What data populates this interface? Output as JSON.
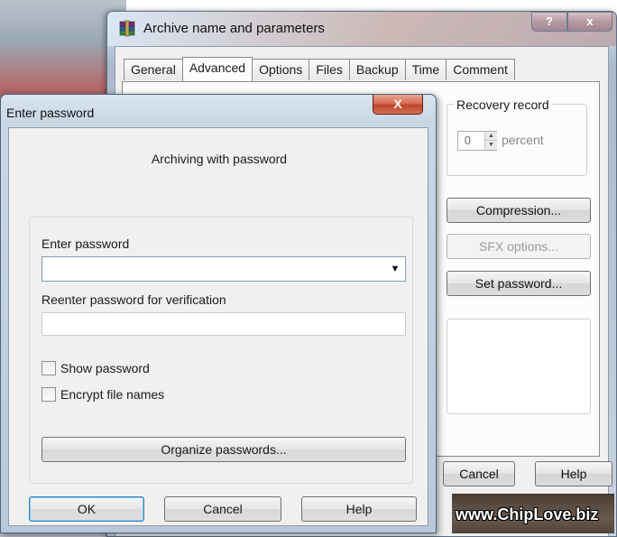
{
  "back_window": {
    "title": "Archive name and parameters",
    "caption_help": "?",
    "caption_close": "x",
    "tabs": [
      "General",
      "Advanced",
      "Options",
      "Files",
      "Backup",
      "Time",
      "Comment"
    ],
    "active_tab": "Advanced",
    "recovery": {
      "label": "Recovery record",
      "value": "0",
      "unit": "percent"
    },
    "buttons": {
      "compression": "Compression...",
      "sfx_options": "SFX options...",
      "set_password": "Set password...",
      "cancel": "Cancel",
      "help": "Help"
    }
  },
  "password_dialog": {
    "title": "Enter password",
    "close_label": "X",
    "heading": "Archiving with password",
    "enter_label": "Enter password",
    "enter_value": "",
    "reenter_label": "Reenter password for verification",
    "reenter_value": "",
    "show_password_label": "Show password",
    "show_password_checked": false,
    "encrypt_names_label": "Encrypt file names",
    "encrypt_names_checked": false,
    "organize_label": "Organize passwords...",
    "ok_label": "OK",
    "cancel_label": "Cancel",
    "help_label": "Help"
  },
  "watermark": "www.ChipLove.biz"
}
